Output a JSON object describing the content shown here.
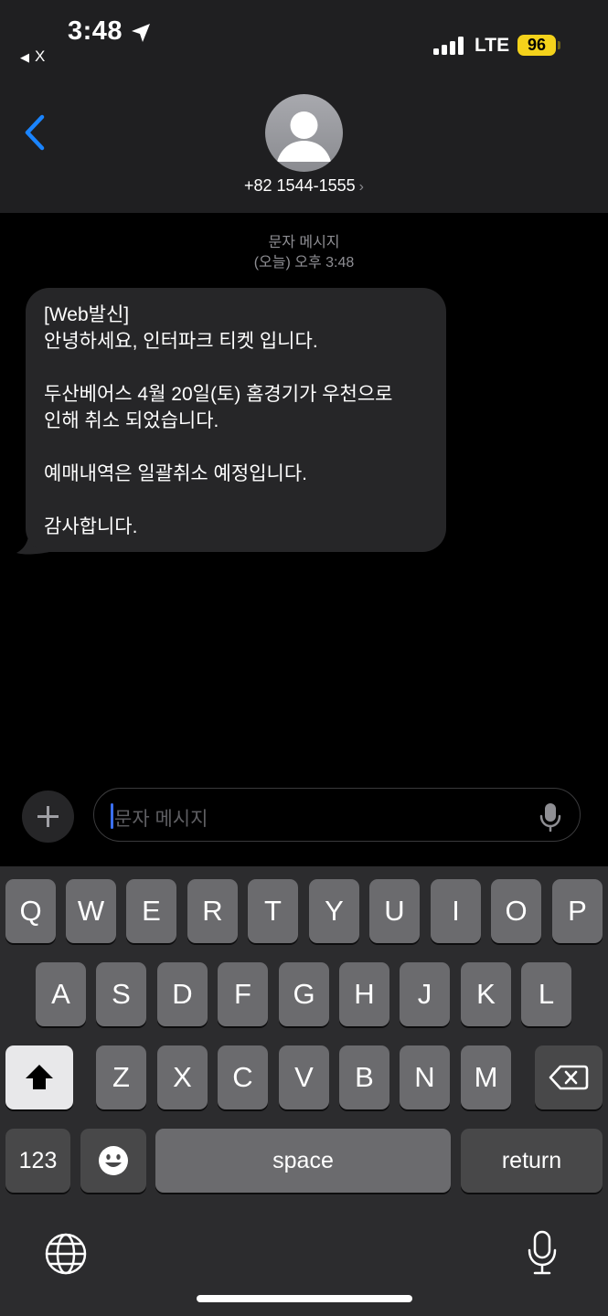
{
  "status_bar": {
    "time": "3:48",
    "back_app": "X",
    "network": "LTE",
    "battery": "96",
    "battery_color": "#f4d21b"
  },
  "header": {
    "contact": "+82 1544-1555",
    "chevron": "›"
  },
  "conversation": {
    "service": "문자 메시지",
    "timestamp": "(오늘) 오후 3:48",
    "message": "[Web발신]\n안녕하세요, 인터파크 티켓 입니다.\n\n두산베어스 4월 20일(토) 홈경기가 우천으로\n인해 취소 되었습니다.\n\n예매내역은 일괄취소 예정입니다.\n\n감사합니다."
  },
  "compose": {
    "placeholder": "문자 메시지"
  },
  "keyboard": {
    "row1": [
      "Q",
      "W",
      "E",
      "R",
      "T",
      "Y",
      "U",
      "I",
      "O",
      "P"
    ],
    "row2": [
      "A",
      "S",
      "D",
      "F",
      "G",
      "H",
      "J",
      "K",
      "L"
    ],
    "row3": [
      "Z",
      "X",
      "C",
      "V",
      "B",
      "N",
      "M"
    ],
    "numbers": "123",
    "space": "space",
    "return": "return"
  },
  "colors": {
    "accent": "#1a84ff",
    "bubble": "#262628",
    "key": "#6b6b6e"
  }
}
